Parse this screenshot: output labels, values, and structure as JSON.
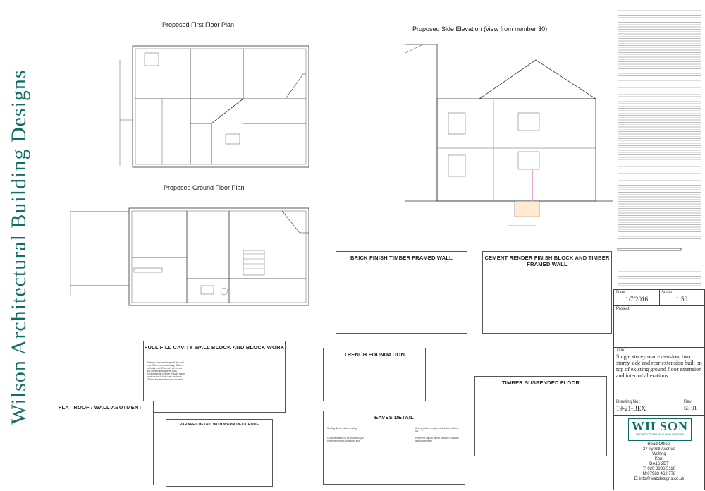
{
  "brand_vertical": "Wilson Architectural Building Designs",
  "plans": {
    "first_floor": "Proposed First Floor Plan",
    "ground_floor": "Proposed Ground Floor Plan",
    "side_elevation": "Proposed Side Elevation  (view from number 30)"
  },
  "details": {
    "brick": "BRICK FINISH TIMBER FRAMED WALL",
    "render": "CEMENT RENDER FINISH BLOCK AND TIMBER FRAMED WALL",
    "cavity": "FULL FILL CAVITY WALL BLOCK AND BLOCK WORK",
    "trench": "TRENCH FOUNDATION",
    "timber_floor": "TIMBER SUSPENDED FLOOR",
    "flat_roof": "FLAT ROOF / WALL ABUTMENT",
    "parapet": "PARAPET DETAIL WITH WARM DECK ROOF",
    "eaves": "EAVES DETAIL"
  },
  "cavity_notes": [
    "Stainless steel retaining wall ties built",
    "in at 750mm c/s horizontally, 450mm",
    "vertically and 225mm c/s at reveals",
    "and corners in staggered rows",
    "Horizontal strip polymer (bituait) damp",
    "proof course to both leafs minimum",
    "150mm above external ground level"
  ],
  "eaves_notes": [
    "Roofing tiles to match existing",
    "Cross ventilation to be provided by a proprietary eaves ventilation strip",
    "Ceiling joists to engineers details at 400mm c/s",
    "Polythene vapour barrier between insulation and plasterboard"
  ],
  "title_block": {
    "date_label": "Date:",
    "date": "1/7/2016",
    "scale_label": "Scale:",
    "scale": "1:50",
    "project_label": "Project:",
    "title_label": "Title:",
    "title": "Single storey rear extension, two storey side and rear extension built on top of existing ground floor extension and internal alterations",
    "drawing_no_label": "Drawing No.:",
    "drawing_no": "19-21-BEX",
    "rev_label": "Rev:",
    "rev": "S3 01"
  },
  "company": {
    "logo": "WILSON",
    "tagline": "ARCHITECTURAL BUILDING DESIGNS",
    "head_office": "Head Office:",
    "address": [
      "27 Tyrrell Avenue",
      "Welling",
      "Kent",
      "DA16 2BT"
    ],
    "tel": "T: 020 8306 5110",
    "mob": "M:07983 462 778",
    "email": "E: info@wabdesigns.co.uk"
  },
  "accent": "#0f6f66",
  "insulation_color": "#e8a9d8"
}
